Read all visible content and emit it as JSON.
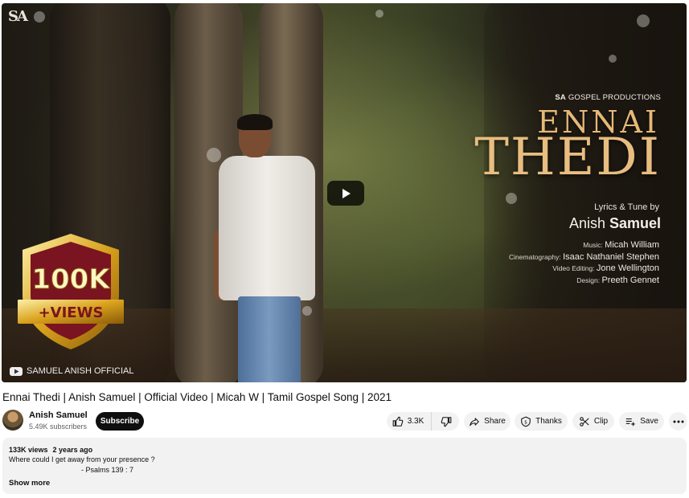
{
  "video": {
    "watermark_logo": "SA",
    "studio_prefix": "SA",
    "studio_suffix": " GOSPEL PRODUCTIONS",
    "title_line1": "ENNAI",
    "title_line2": "THEDI",
    "lyrics_label": "Lyrics & Tune by",
    "composer_first": "Anish ",
    "composer_last": "Samuel",
    "credits": [
      {
        "label": "Music: ",
        "value": "Micah William"
      },
      {
        "label": "Cinematography: ",
        "value": "Isaac Nathaniel Stephen"
      },
      {
        "label": "Video Editing: ",
        "value": "Jone Wellington"
      },
      {
        "label": "Design: ",
        "value": "Preeth Gennet"
      }
    ],
    "badge_number": "100K",
    "badge_text": "+VIEWS",
    "channel_watermark": "SAMUEL ANISH OFFICIAL"
  },
  "page": {
    "title": "Ennai Thedi | Anish Samuel | Official Video | Micah W | Tamil Gospel Song | 2021",
    "channel": {
      "name": "Anish Samuel",
      "subscribers": "5.49K subscribers"
    },
    "subscribe_label": "Subscribe",
    "actions": {
      "likes": "3.3K",
      "share": "Share",
      "thanks": "Thanks",
      "clip": "Clip",
      "save": "Save"
    },
    "description": {
      "views": "133K views",
      "age": "2 years ago",
      "line1": "Where could I get away from your presence ?",
      "line2": "- Psalms 139 : 7",
      "show_more": "Show more"
    }
  },
  "colors": {
    "accent_gold": "#e8bd80",
    "badge_red": "#7a1420",
    "button_dark": "#0f0f0f",
    "pill_bg": "#f2f2f2"
  }
}
